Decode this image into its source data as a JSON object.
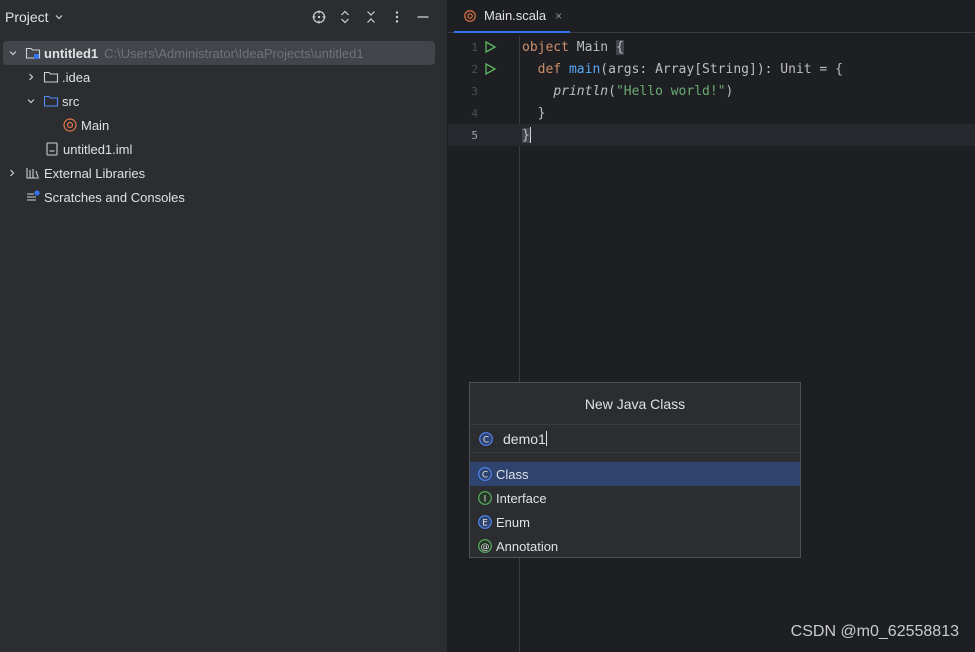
{
  "project_panel": {
    "title": "Project",
    "tools": [
      "locate-icon",
      "expand-all-icon",
      "collapse-all-icon",
      "more-options-icon",
      "hide-icon"
    ],
    "tree": [
      {
        "label": "untitled1",
        "hint": "C:\\Users\\Administrator\\IdeaProjects\\untitled1",
        "icon": "module-folder-icon",
        "expanded": true
      },
      {
        "label": ".idea",
        "icon": "folder-icon",
        "expanded": false
      },
      {
        "label": "src",
        "icon": "source-folder-icon",
        "expanded": true
      },
      {
        "label": "Main",
        "icon": "scala-object-icon"
      },
      {
        "label": "untitled1.iml",
        "icon": "iml-file-icon"
      },
      {
        "label": "External Libraries",
        "icon": "library-icon",
        "expanded": false
      },
      {
        "label": "Scratches and Consoles",
        "icon": "scratches-icon"
      }
    ]
  },
  "editor": {
    "tab": {
      "label": "Main.scala",
      "close": "×",
      "icon": "scala-object-icon"
    },
    "lines": [
      {
        "num": "1",
        "kw1": "object",
        "rest1": " Main ",
        "brace": "{"
      },
      {
        "num": "2",
        "indent": "  ",
        "kw": "def",
        "fn": " main",
        "rest": "(args: Array[String]): Unit = {"
      },
      {
        "num": "3",
        "indent": "    ",
        "call": "println",
        "open": "(",
        "str": "\"Hello world!\"",
        "close": ")"
      },
      {
        "num": "4",
        "text": "  }"
      },
      {
        "num": "5",
        "text": "}"
      }
    ]
  },
  "dialog": {
    "title": "New Java Class",
    "name_value": "demo1",
    "kinds": [
      {
        "label": "Class",
        "icon": "class-icon",
        "letter": "C",
        "color": "#548af7",
        "selected": true
      },
      {
        "label": "Interface",
        "icon": "interface-icon",
        "letter": "I",
        "color": "#5fb865",
        "selected": false
      },
      {
        "label": "Enum",
        "icon": "enum-icon",
        "letter": "E",
        "color": "#548af7",
        "selected": false
      },
      {
        "label": "Annotation",
        "icon": "annotation-icon",
        "letter": "@",
        "color": "#5fb865",
        "selected": false
      }
    ]
  },
  "watermark": "CSDN @m0_62558813",
  "colors": {
    "accent": "#3574f0",
    "selection": "#2e436e",
    "keyword": "#cf8e6d",
    "function": "#56a8f5",
    "string": "#6aab73",
    "scala_icon": "#e0744a"
  }
}
